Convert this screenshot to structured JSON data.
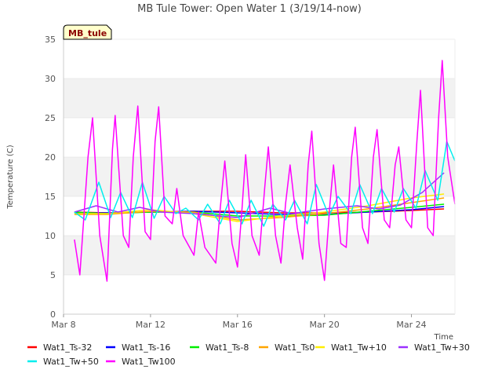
{
  "chart_data": {
    "type": "line",
    "title": "MB Tule Tower: Open Water 1 (3/19/14-now)",
    "xlabel": "Time",
    "ylabel": "Temperature (C)",
    "station_badge": "MB_tule",
    "x_range": [
      "2014-03-08",
      "2014-03-26"
    ],
    "ylim": [
      0,
      35
    ],
    "y_ticks": [
      0,
      5,
      10,
      15,
      20,
      25,
      30,
      35
    ],
    "x_ticks": [
      {
        "date": "2014-03-08",
        "label": "Mar 8"
      },
      {
        "date": "2014-03-12",
        "label": "Mar 12"
      },
      {
        "date": "2014-03-16",
        "label": "Mar 16"
      },
      {
        "date": "2014-03-20",
        "label": "Mar 20"
      },
      {
        "date": "2014-03-24",
        "label": "Mar 24"
      }
    ],
    "grid": "alternating horizontal bands",
    "legend_position": "bottom",
    "series": [
      {
        "name": "Wat1_Ts-32",
        "color": "#ff0000",
        "points": [
          [
            "2014-03-08T12",
            13.0
          ],
          [
            "2014-03-10",
            12.9
          ],
          [
            "2014-03-12",
            13.0
          ],
          [
            "2014-03-14",
            13.1
          ],
          [
            "2014-03-16",
            13.1
          ],
          [
            "2014-03-18",
            12.9
          ],
          [
            "2014-03-20",
            12.9
          ],
          [
            "2014-03-22",
            13.0
          ],
          [
            "2014-03-24",
            13.2
          ],
          [
            "2014-03-25T12",
            13.4
          ]
        ]
      },
      {
        "name": "Wat1_Ts-16",
        "color": "#0000ff",
        "points": [
          [
            "2014-03-08T12",
            12.9
          ],
          [
            "2014-03-10",
            12.9
          ],
          [
            "2014-03-12",
            13.0
          ],
          [
            "2014-03-14",
            13.1
          ],
          [
            "2014-03-16",
            12.9
          ],
          [
            "2014-03-18",
            12.7
          ],
          [
            "2014-03-20",
            12.7
          ],
          [
            "2014-03-22",
            13.0
          ],
          [
            "2014-03-24",
            13.3
          ],
          [
            "2014-03-25T12",
            13.7
          ]
        ]
      },
      {
        "name": "Wat1_Ts-8",
        "color": "#00ee00",
        "points": [
          [
            "2014-03-08T12",
            13.0
          ],
          [
            "2014-03-10",
            12.8
          ],
          [
            "2014-03-12",
            13.0
          ],
          [
            "2014-03-14",
            13.0
          ],
          [
            "2014-03-16",
            12.5
          ],
          [
            "2014-03-18",
            12.5
          ],
          [
            "2014-03-20",
            12.6
          ],
          [
            "2014-03-22",
            13.1
          ],
          [
            "2014-03-24",
            13.6
          ],
          [
            "2014-03-25T12",
            14.0
          ]
        ]
      },
      {
        "name": "Wat1_Ts0",
        "color": "#ffa500",
        "points": [
          [
            "2014-03-08T12",
            12.7
          ],
          [
            "2014-03-10",
            12.7
          ],
          [
            "2014-03-12",
            13.1
          ],
          [
            "2014-03-14",
            13.0
          ],
          [
            "2014-03-16",
            12.0
          ],
          [
            "2014-03-18",
            12.3
          ],
          [
            "2014-03-20",
            12.8
          ],
          [
            "2014-03-22",
            13.4
          ],
          [
            "2014-03-24",
            14.2
          ],
          [
            "2014-03-25T12",
            14.8
          ]
        ]
      },
      {
        "name": "Wat1_Tw+10",
        "color": "#ffee00",
        "points": [
          [
            "2014-03-08T12",
            12.8
          ],
          [
            "2014-03-10",
            12.8
          ],
          [
            "2014-03-12",
            13.3
          ],
          [
            "2014-03-14",
            12.8
          ],
          [
            "2014-03-16",
            11.8
          ],
          [
            "2014-03-18",
            12.5
          ],
          [
            "2014-03-20",
            13.0
          ],
          [
            "2014-03-22",
            13.8
          ],
          [
            "2014-03-24",
            14.8
          ],
          [
            "2014-03-25T12",
            15.3
          ]
        ]
      },
      {
        "name": "Wat1_Tw+30",
        "color": "#9b30ff",
        "points": [
          [
            "2014-03-08T12",
            13.0
          ],
          [
            "2014-03-09T12",
            13.8
          ],
          [
            "2014-03-10T12",
            13.0
          ],
          [
            "2014-03-11T12",
            13.6
          ],
          [
            "2014-03-12T12",
            13.0
          ],
          [
            "2014-03-14",
            12.8
          ],
          [
            "2014-03-16",
            12.3
          ],
          [
            "2014-03-17T12",
            13.5
          ],
          [
            "2014-03-18T12",
            12.8
          ],
          [
            "2014-03-20",
            13.4
          ],
          [
            "2014-03-21T12",
            13.8
          ],
          [
            "2014-03-22T12",
            13.4
          ],
          [
            "2014-03-23T12",
            13.9
          ],
          [
            "2014-03-24T12",
            15.5
          ],
          [
            "2014-03-25T12",
            18.0
          ]
        ]
      },
      {
        "name": "Wat1_Tw+50",
        "color": "#00eeee",
        "points": [
          [
            "2014-03-08T12",
            13.0
          ],
          [
            "2014-03-09",
            12.0
          ],
          [
            "2014-03-09T15",
            16.8
          ],
          [
            "2014-03-10T04",
            12.3
          ],
          [
            "2014-03-10T15",
            15.5
          ],
          [
            "2014-03-11T04",
            12.3
          ],
          [
            "2014-03-11T15",
            16.8
          ],
          [
            "2014-03-12T04",
            12.2
          ],
          [
            "2014-03-12T15",
            15.0
          ],
          [
            "2014-03-13T04",
            12.8
          ],
          [
            "2014-03-13T15",
            13.5
          ],
          [
            "2014-03-14T05",
            12.0
          ],
          [
            "2014-03-14T15",
            14.0
          ],
          [
            "2014-03-15T05",
            11.5
          ],
          [
            "2014-03-15T15",
            14.5
          ],
          [
            "2014-03-16T05",
            11.5
          ],
          [
            "2014-03-16T15",
            14.5
          ],
          [
            "2014-03-17T05",
            11.2
          ],
          [
            "2014-03-17T15",
            14.0
          ],
          [
            "2014-03-18T05",
            12.0
          ],
          [
            "2014-03-18T15",
            14.5
          ],
          [
            "2014-03-19T05",
            11.5
          ],
          [
            "2014-03-19T15",
            16.5
          ],
          [
            "2014-03-20T05",
            12.5
          ],
          [
            "2014-03-20T15",
            15.0
          ],
          [
            "2014-03-21T05",
            12.8
          ],
          [
            "2014-03-21T15",
            16.5
          ],
          [
            "2014-03-22T05",
            12.8
          ],
          [
            "2014-03-22T15",
            16.0
          ],
          [
            "2014-03-23T05",
            13.0
          ],
          [
            "2014-03-23T15",
            16.0
          ],
          [
            "2014-03-24T05",
            13.5
          ],
          [
            "2014-03-24T15",
            18.3
          ],
          [
            "2014-03-25T05",
            14.5
          ],
          [
            "2014-03-25T15",
            22.0
          ],
          [
            "2014-03-26",
            19.5
          ]
        ]
      },
      {
        "name": "Wat1_Tw100",
        "color": "#ff00ff",
        "points": [
          [
            "2014-03-08T12",
            9.5
          ],
          [
            "2014-03-08T18",
            5.0
          ],
          [
            "2014-03-09T03",
            20.0
          ],
          [
            "2014-03-09T08",
            25.0
          ],
          [
            "2014-03-09T16",
            10.0
          ],
          [
            "2014-03-10T00",
            4.2
          ],
          [
            "2014-03-10T06",
            21.0
          ],
          [
            "2014-03-10T09",
            25.3
          ],
          [
            "2014-03-10T18",
            10.0
          ],
          [
            "2014-03-11T00",
            8.5
          ],
          [
            "2014-03-11T05",
            20.0
          ],
          [
            "2014-03-11T10",
            26.5
          ],
          [
            "2014-03-11T18",
            10.5
          ],
          [
            "2014-03-12T00",
            9.5
          ],
          [
            "2014-03-12T05",
            22.0
          ],
          [
            "2014-03-12T09",
            26.4
          ],
          [
            "2014-03-12T16",
            12.5
          ],
          [
            "2014-03-13T00",
            11.5
          ],
          [
            "2014-03-13T05",
            16.0
          ],
          [
            "2014-03-13T12",
            10.0
          ],
          [
            "2014-03-14T00",
            7.5
          ],
          [
            "2014-03-14T05",
            13.0
          ],
          [
            "2014-03-14T12",
            8.5
          ],
          [
            "2014-03-15T00",
            6.5
          ],
          [
            "2014-03-15T05",
            13.5
          ],
          [
            "2014-03-15T10",
            19.5
          ],
          [
            "2014-03-15T18",
            9.0
          ],
          [
            "2014-03-16T00",
            6.0
          ],
          [
            "2014-03-16T05",
            13.5
          ],
          [
            "2014-03-16T09",
            20.3
          ],
          [
            "2014-03-16T16",
            10.0
          ],
          [
            "2014-03-17T00",
            7.5
          ],
          [
            "2014-03-17T06",
            16.0
          ],
          [
            "2014-03-17T10",
            21.3
          ],
          [
            "2014-03-17T18",
            10.0
          ],
          [
            "2014-03-18T00",
            6.5
          ],
          [
            "2014-03-18T05",
            14.0
          ],
          [
            "2014-03-18T10",
            19.0
          ],
          [
            "2014-03-18T18",
            11.0
          ],
          [
            "2014-03-19T00",
            7.0
          ],
          [
            "2014-03-19T06",
            19.0
          ],
          [
            "2014-03-19T10",
            23.3
          ],
          [
            "2014-03-19T18",
            9.0
          ],
          [
            "2014-03-20T00",
            4.3
          ],
          [
            "2014-03-20T06",
            14.0
          ],
          [
            "2014-03-20T10",
            19.0
          ],
          [
            "2014-03-20T18",
            9.0
          ],
          [
            "2014-03-21T00",
            8.5
          ],
          [
            "2014-03-21T06",
            20.0
          ],
          [
            "2014-03-21T10",
            23.8
          ],
          [
            "2014-03-21T18",
            11.0
          ],
          [
            "2014-03-22T00",
            9.0
          ],
          [
            "2014-03-22T06",
            20.0
          ],
          [
            "2014-03-22T10",
            23.5
          ],
          [
            "2014-03-22T18",
            12.0
          ],
          [
            "2014-03-23T00",
            11.0
          ],
          [
            "2014-03-23T06",
            19.0
          ],
          [
            "2014-03-23T10",
            21.3
          ],
          [
            "2014-03-23T18",
            12.0
          ],
          [
            "2014-03-24T00",
            11.0
          ],
          [
            "2014-03-24T06",
            22.0
          ],
          [
            "2014-03-24T10",
            28.5
          ],
          [
            "2014-03-24T18",
            11.0
          ],
          [
            "2014-03-25T00",
            10.0
          ],
          [
            "2014-03-25T06",
            25.0
          ],
          [
            "2014-03-25T10",
            32.3
          ],
          [
            "2014-03-25T16",
            20.0
          ],
          [
            "2014-03-26",
            14.0
          ]
        ]
      }
    ]
  }
}
